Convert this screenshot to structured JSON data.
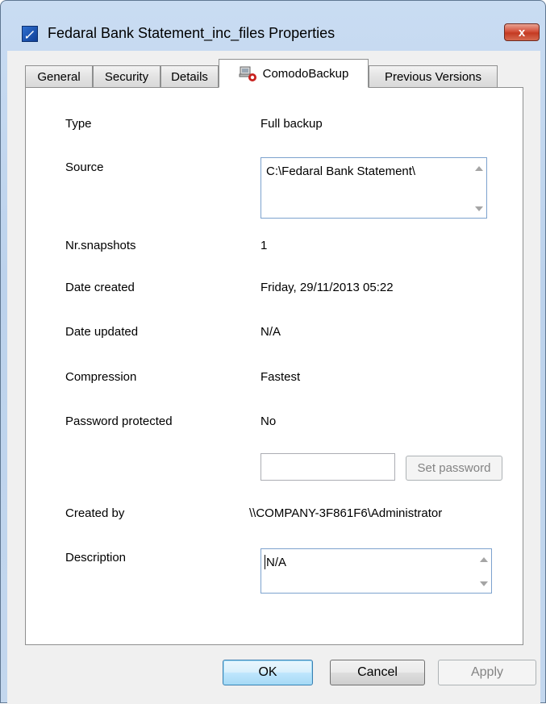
{
  "window": {
    "title": "Fedaral Bank Statement_inc_files Properties",
    "close_glyph": "x"
  },
  "tabs": [
    {
      "label": "General",
      "active": false
    },
    {
      "label": "Security",
      "active": false
    },
    {
      "label": "Details",
      "active": false
    },
    {
      "label": "ComodoBackup",
      "active": true,
      "icon": "comodo-backup-icon"
    },
    {
      "label": "Previous Versions",
      "active": false
    }
  ],
  "props": {
    "type": {
      "label": "Type",
      "value": "Full backup"
    },
    "source": {
      "label": "Source",
      "value": "C:\\Fedaral Bank Statement\\"
    },
    "snapshots": {
      "label": "Nr.snapshots",
      "value": "1"
    },
    "created": {
      "label": "Date created",
      "value": "Friday, 29/11/2013 05:22"
    },
    "updated": {
      "label": "Date updated",
      "value": "N/A"
    },
    "compression": {
      "label": "Compression",
      "value": "Fastest"
    },
    "password": {
      "label": "Password protected",
      "value": "No",
      "input_value": "",
      "set_button": "Set password"
    },
    "created_by": {
      "label": "Created by",
      "value": "\\\\COMPANY-3F861F6\\Administrator"
    },
    "description": {
      "label": "Description",
      "value": "N/A"
    }
  },
  "buttons": {
    "ok": "OK",
    "cancel": "Cancel",
    "apply": "Apply"
  },
  "colors": {
    "frame": "#c3d7ee",
    "close": "#c43a22",
    "accent_border": "#3c7fb1"
  }
}
